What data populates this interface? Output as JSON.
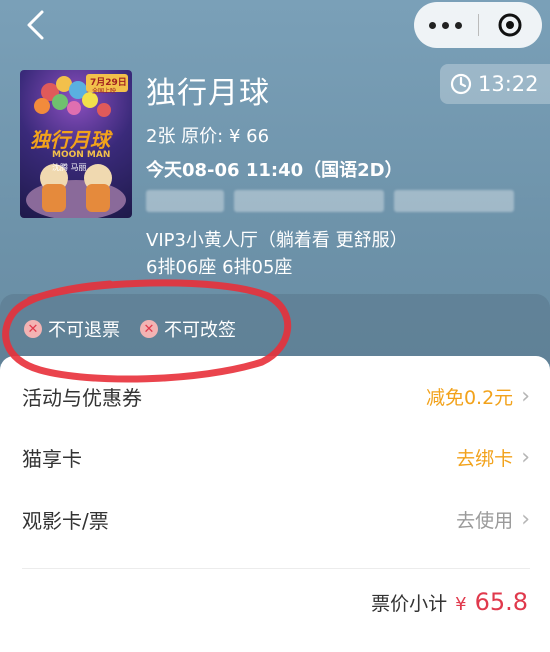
{
  "nav": {
    "back_icon": "chevron-left-icon",
    "more_icon": "more-dots-icon",
    "close_icon": "target-circle-icon"
  },
  "movie": {
    "title": "独行月球",
    "timer": "13:22",
    "price_line": "2张 原价: ¥ 66",
    "show_line": "今天08-06 11:40（国语2D）",
    "hall": "VIP3小黄人厅（躺着看 更舒服）",
    "seats": "6排06座 6排05座",
    "poster": {
      "date_badge": "7月29日",
      "badge_sub": "全国上映",
      "title": "独行月球",
      "subtitle": "MOON MAN",
      "cast": "沈腾 马丽"
    }
  },
  "tags": [
    "不可退票",
    "不可改签"
  ],
  "rows": [
    {
      "label": "活动与优惠券",
      "value": "减免0.2元",
      "color": "#f2a21b"
    },
    {
      "label": "猫享卡",
      "value": "去绑卡",
      "color": "#f2a21b"
    },
    {
      "label": "观影卡/票",
      "value": "去使用",
      "color": "#9a9a9a"
    }
  ],
  "subtotal": {
    "label": "票价小计",
    "currency": "¥",
    "amount": "65.8"
  },
  "colors": {
    "accent_orange": "#f2a21b",
    "price_red": "#e0394c",
    "annotation_red": "#e8303a"
  }
}
